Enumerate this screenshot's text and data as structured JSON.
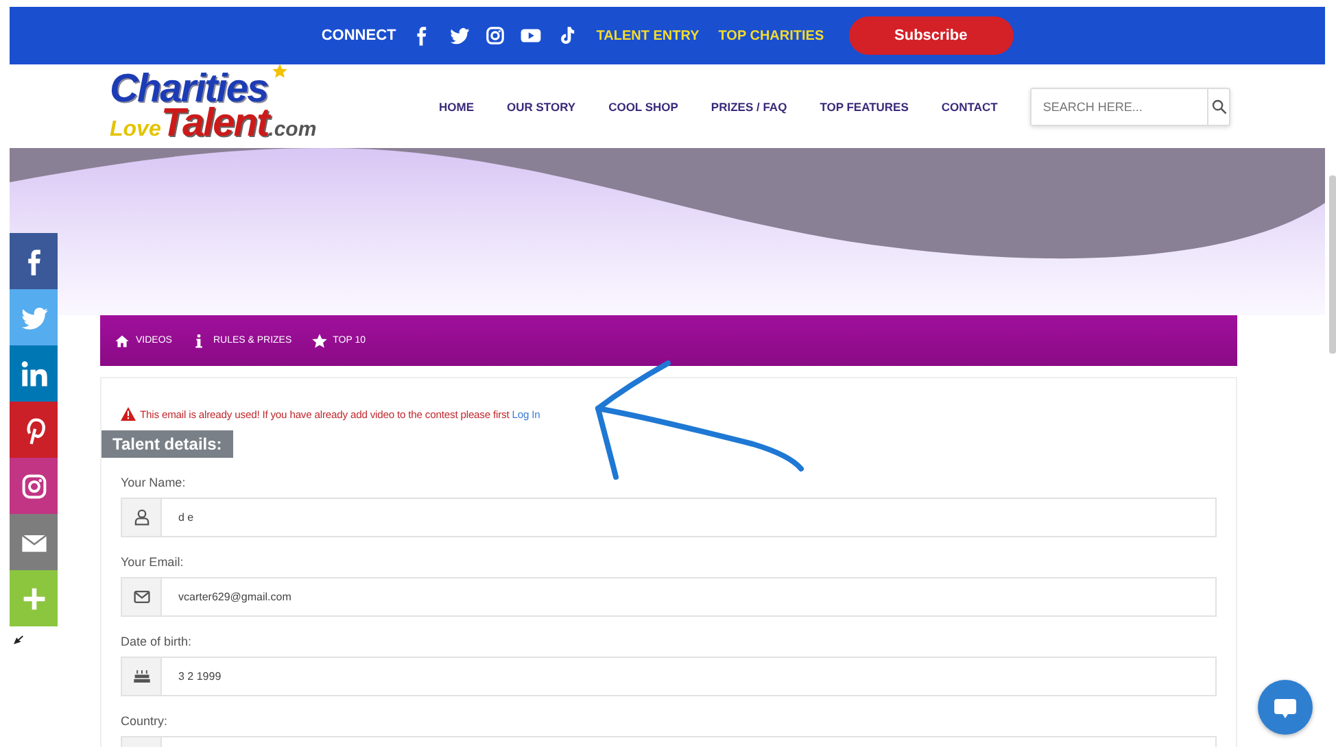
{
  "top_bar": {
    "connect": "CONNECT",
    "links": [
      {
        "label": "TALENT ENTRY"
      },
      {
        "label": "TOP CHARITIES"
      }
    ],
    "subscribe": "Subscribe"
  },
  "header": {
    "logo": {
      "line1": "Charities",
      "love": "Love",
      "talent": "Talent",
      "domain": ".com"
    },
    "nav": [
      {
        "label": "HOME"
      },
      {
        "label": "OUR STORY"
      },
      {
        "label": "COOL SHOP"
      },
      {
        "label": "PRIZES / FAQ"
      },
      {
        "label": "TOP FEATURES"
      },
      {
        "label": "CONTACT"
      }
    ],
    "search": {
      "placeholder": "SEARCH HERE..."
    }
  },
  "contest_nav": [
    {
      "label": "VIDEOS"
    },
    {
      "label": "RULES & PRIZES"
    },
    {
      "label": "TOP 10"
    }
  ],
  "alert": {
    "message": "This email is already used! If you have already add video to the contest please first",
    "link": "Log In"
  },
  "section_title": "Talent details:",
  "fields": [
    {
      "label": "Your Name:",
      "value": "d e"
    },
    {
      "label": "Your Email:",
      "value": "vcarter629@gmail.com"
    },
    {
      "label": "Date of birth:",
      "value": "3 2 1999"
    },
    {
      "label": "Country:"
    }
  ]
}
